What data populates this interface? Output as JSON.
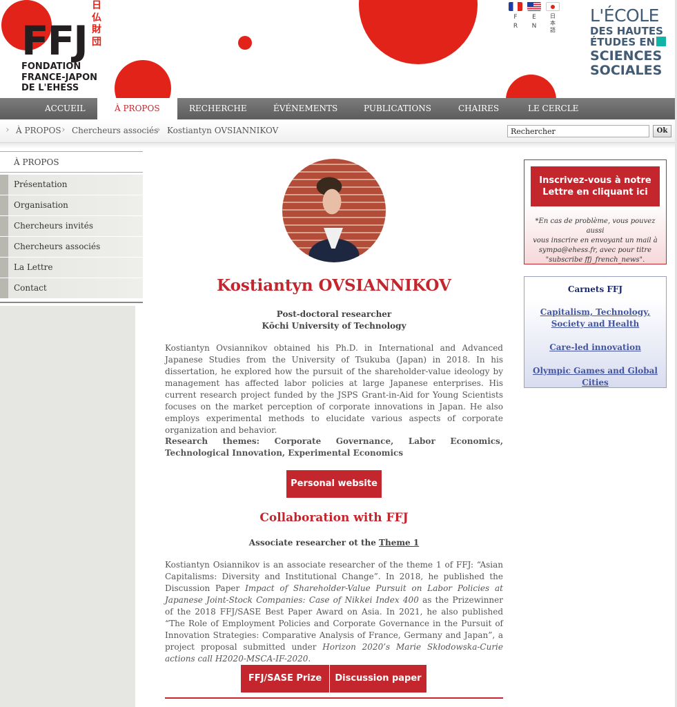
{
  "header": {
    "logo_ffj": "FFJ",
    "logo_kanji": [
      "日",
      "仏",
      "財",
      "団"
    ],
    "logo_sub": [
      "FONDATION",
      "FRANCE-JAPON",
      "DE L'EHESS"
    ],
    "languages": [
      {
        "code_lines": [
          "F",
          "R"
        ],
        "flag": "france-flag"
      },
      {
        "code_lines": [
          "E",
          "N"
        ],
        "flag": "usa-flag"
      },
      {
        "code_lines": [
          "日",
          "本",
          "語"
        ],
        "flag": "japan-flag"
      }
    ],
    "ehess": {
      "line1": "L'ÉCOLE",
      "line2": "DES HAUTES",
      "line3": "ÉTUDES EN",
      "line4": "SCIENCES",
      "line5": "SOCIALES"
    },
    "accent_color": "#e2231a"
  },
  "nav": {
    "items": [
      "ACCUEIL",
      "À PROPOS",
      "RECHERCHE",
      "ÉVÉNEMENTS",
      "PUBLICATIONS",
      "CHAIRES",
      "LE CERCLE"
    ],
    "active": "À PROPOS"
  },
  "breadcrumb": {
    "items": [
      "À PROPOS",
      "Chercheurs associés",
      "Kostiantyn OVSIANNIKOV"
    ],
    "separator": "›"
  },
  "search": {
    "value": "Rechercher",
    "button": "Ok"
  },
  "sidebar": {
    "title": "À PROPOS",
    "items": [
      "Présentation",
      "Organisation",
      "Chercheurs invités",
      "Chercheurs associés",
      "La Lettre",
      "Contact"
    ]
  },
  "profile": {
    "name": "Kostiantyn OVSIANNIKOV",
    "position": "Post-doctoral researcher",
    "institution": "Kōchi University of Technology",
    "bio": "Kostiantyn Ovsiannikov obtained his Ph.D. in International and Advanced Japanese Studies from the University of Tsukuba (Japan) in 2018. In his dissertation, he explored how the pursuit of the shareholder-value ideology by management has affected labor policies at large Japanese enterprises. His current research project funded by the JSPS Grant-in-Aid for Young Scientists focuses on the market perception of corporate innovations in Japan. He also employs experimental methods to elucidate various aspects of corporate organization and behavior.",
    "themes": "Research themes: Corporate Governance, Labor Economics, Technological Innovation, Experimental Economics",
    "website_button": "Personal website"
  },
  "collaboration": {
    "title": "Collaboration with FFJ",
    "associate_prefix": "Associate researcher ot the ",
    "associate_link": "Theme 1",
    "text_1": "Kostiantyn Osiannikov is an associate researcher of the theme 1 of FFJ: “Asian Capitalisms: Diversity and Institutional Change”. In 2018, he published the Discussion Paper ",
    "text_italic_1": "Impact of Shareholder-Value Pursuit on Labor Policies at Japanese Joint-Stock Companies: Case of Nikkei Index 400",
    "text_2": " as the Prizewinner of the 2018 FFJ/SASE Best Paper Award on Asia. In 2021, he also published “The Role of Employment Policies and Corporate Governance in the Pursuit of Innovation Strategies: Comparative Analysis of France, Germany and Japan”, a project proposal submitted under ",
    "text_italic_2": "Horizon 2020’s Marie Skłodowska-Curie actions call H2020-MSCA-IF-2020.",
    "buttons": [
      "FFJ/SASE Prize",
      "Discussion paper"
    ]
  },
  "newsletter": {
    "button_lines": [
      "Inscrivez-vous à notre",
      "Lettre en cliquant ici"
    ],
    "note_lines": [
      "*En cas de problème, vous pouvez aussi",
      "vous inscrire en envoyant un mail à",
      "sympa@ehess.fr, avec pour titre",
      "\"subscribe ffj_french_news\"."
    ]
  },
  "carnets": {
    "title": "Carnets FFJ",
    "links": [
      [
        "Capitalism, Technology,",
        "Society and Health"
      ],
      [
        "Care-led innovation"
      ],
      [
        "Olympic Games and Global",
        "Cities"
      ]
    ]
  }
}
